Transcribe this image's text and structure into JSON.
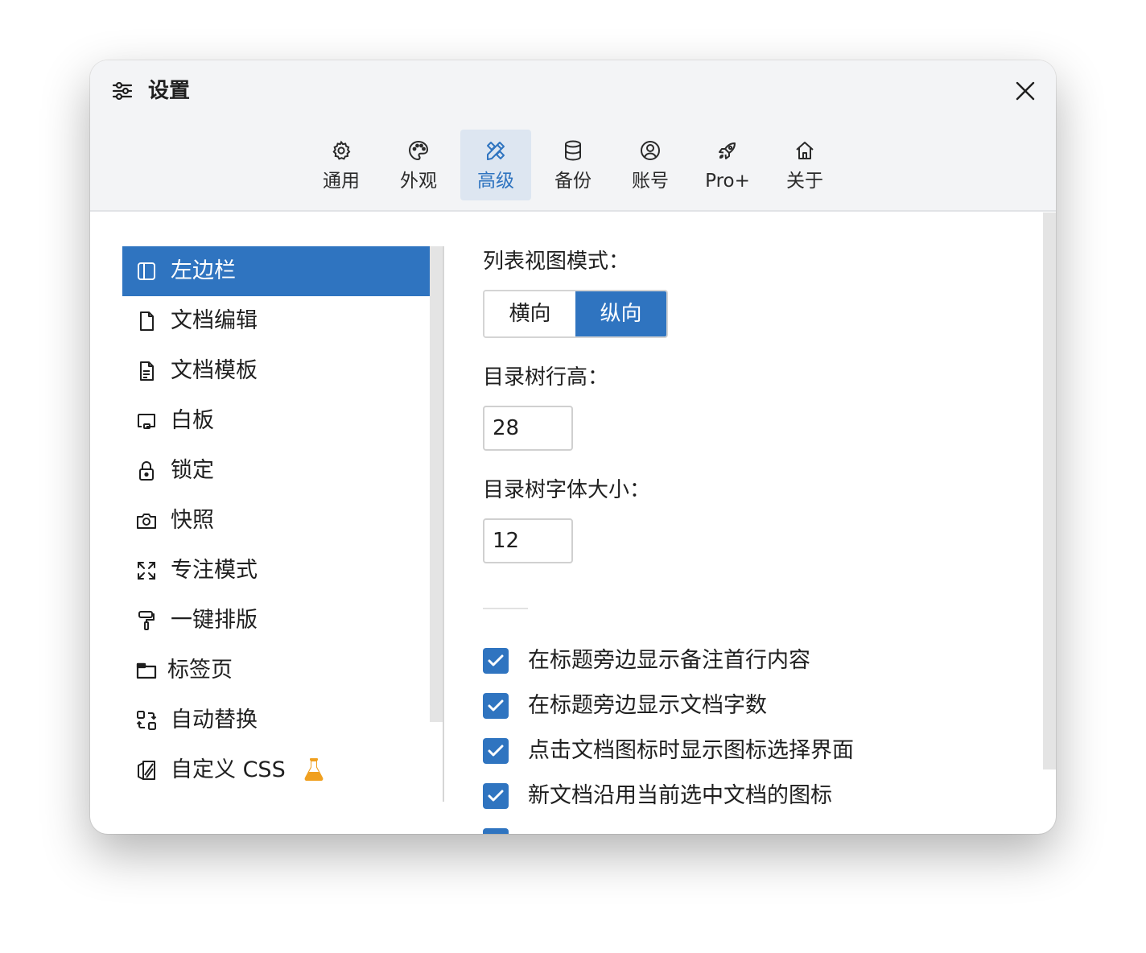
{
  "window": {
    "title": "设置"
  },
  "tabs": [
    {
      "label": "通用",
      "icon": "gear-icon",
      "active": false
    },
    {
      "label": "外观",
      "icon": "palette-icon",
      "active": false
    },
    {
      "label": "高级",
      "icon": "tools-icon",
      "active": true
    },
    {
      "label": "备份",
      "icon": "database-icon",
      "active": false
    },
    {
      "label": "账号",
      "icon": "user-circle-icon",
      "active": false
    },
    {
      "label": "Pro+",
      "icon": "rocket-icon",
      "active": false
    },
    {
      "label": "关于",
      "icon": "home-icon",
      "active": false
    }
  ],
  "sidebar": {
    "items": [
      {
        "label": "左边栏",
        "icon": "sidebar-icon",
        "active": true
      },
      {
        "label": "文档编辑",
        "icon": "file-icon",
        "active": false
      },
      {
        "label": "文档模板",
        "icon": "file-text-icon",
        "active": false
      },
      {
        "label": "白板",
        "icon": "whiteboard-icon",
        "active": false
      },
      {
        "label": "锁定",
        "icon": "lock-icon",
        "active": false
      },
      {
        "label": "快照",
        "icon": "camera-icon",
        "active": false
      },
      {
        "label": "专注模式",
        "icon": "expand-icon",
        "active": false
      },
      {
        "label": "一键排版",
        "icon": "paint-roller-icon",
        "active": false
      },
      {
        "label": "标签页",
        "icon": "folder-tab-icon",
        "active": false
      },
      {
        "label": "自动替换",
        "icon": "replace-icon",
        "active": false
      },
      {
        "label": "自定义 CSS",
        "icon": "css-icon",
        "active": false,
        "badge": "flask-icon"
      }
    ]
  },
  "settings": {
    "list_view_mode": {
      "label": "列表视图模式：",
      "options": [
        "横向",
        "纵向"
      ],
      "selected": "纵向"
    },
    "tree_row_height": {
      "label": "目录树行高：",
      "value": "28"
    },
    "tree_font_size": {
      "label": "目录树字体大小：",
      "value": "12"
    },
    "checkboxes": [
      {
        "label": "在标题旁边显示备注首行内容",
        "checked": true
      },
      {
        "label": "在标题旁边显示文档字数",
        "checked": true
      },
      {
        "label": "点击文档图标时显示图标选择界面",
        "checked": true
      },
      {
        "label": "新文档沿用当前选中文档的图标",
        "checked": true
      }
    ]
  },
  "colors": {
    "accent": "#2f74c0",
    "header_bg": "#f3f4f6",
    "flask": "#f0a020"
  }
}
